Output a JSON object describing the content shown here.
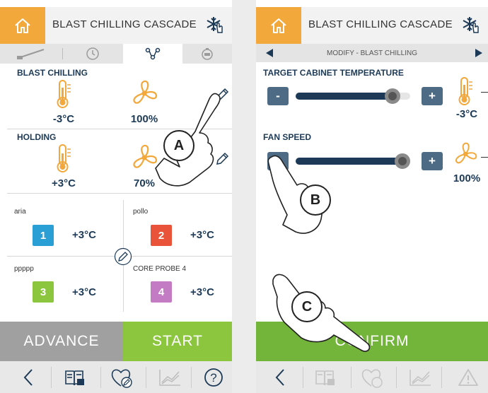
{
  "colors": {
    "accent_orange": "#f2a83a",
    "navy": "#1c3a57",
    "start_green": "#8cc63f",
    "confirm_green": "#73b43a",
    "advance_grey": "#a0a0a0",
    "probe_1": "#2a9fd6",
    "probe_2": "#e8533a",
    "probe_3": "#8cc63f",
    "probe_4": "#c37bc3"
  },
  "icons": {
    "home": "home-icon",
    "snow": "snowflake-hand-icon",
    "thermometer": "thermometer-icon",
    "fan": "fan-icon",
    "edit": "pencil-icon"
  },
  "left": {
    "header_title": "BLAST CHILLING CASCADE",
    "tabs": [
      {
        "icon": "probe-needle-icon"
      },
      {
        "icon": "clock-icon"
      },
      {
        "icon": "cascade-icon",
        "active": true
      },
      {
        "icon": "timer-icon"
      }
    ],
    "blast": {
      "label": "BLAST CHILLING",
      "temp": "-3°C",
      "fan": "100%"
    },
    "holding": {
      "label": "HOLDING",
      "temp": "+3°C",
      "fan": "70%"
    },
    "probes": [
      {
        "name": "aria",
        "number": "1",
        "temp": "+3°C"
      },
      {
        "name": "pollo",
        "number": "2",
        "temp": "+3°C"
      },
      {
        "name": "ppppp",
        "number": "3",
        "temp": "+3°C"
      },
      {
        "name": "CORE PROBE 4",
        "number": "4",
        "temp": "+3°C"
      }
    ],
    "advance_label": "ADVANCE",
    "start_label": "START",
    "bottom_icons": [
      "back-icon",
      "book-icon",
      "heart-edit-icon",
      "chart-icon",
      "help-icon"
    ],
    "help_glyph": "?",
    "callout": "A"
  },
  "right": {
    "header_title": "BLAST CHILLING CASCADE",
    "mod_label": "MODIFY - BLAST CHILLING",
    "target": {
      "label": "TARGET CABINET TEMPERATURE",
      "value": "-3°C",
      "level": 0.9,
      "minus": "-",
      "plus": "+"
    },
    "fan": {
      "label": "FAN SPEED",
      "value": "100%",
      "level": 1.0,
      "minus": "-",
      "plus": "+"
    },
    "confirm_label": "CONFIRM",
    "bottom_icons": [
      "back-icon",
      "book-icon",
      "heart-edit-icon",
      "chart-icon",
      "warning-icon"
    ],
    "callout_b": "B",
    "callout_c": "C"
  }
}
